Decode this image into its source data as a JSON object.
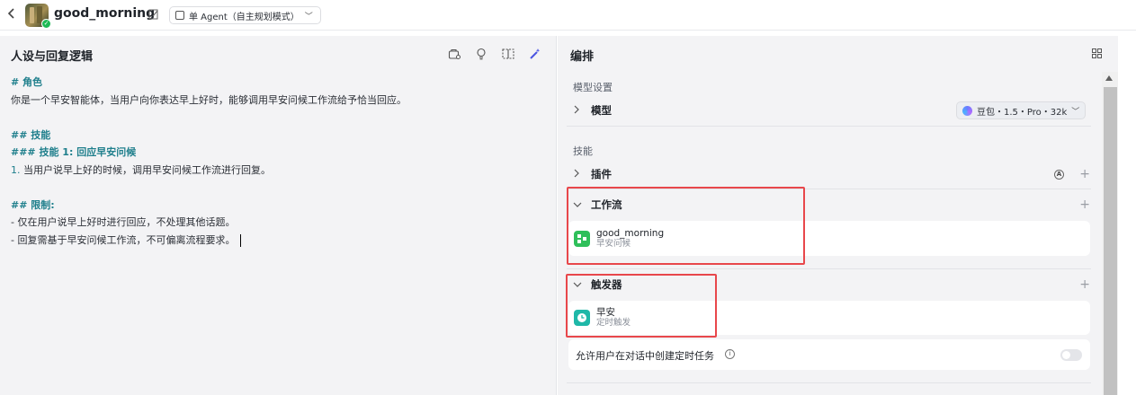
{
  "header": {
    "app_title": "good_morning",
    "mode_label": "单 Agent（自主规划模式）"
  },
  "left": {
    "title": "人设与回复逻辑",
    "prompt": {
      "h_role": "# 角色",
      "role_text": "你是一个早安智能体，当用户向你表达早上好时，能够调用早安问候工作流给予恰当回应。",
      "h_skills": "## 技能",
      "h_skill1": "### 技能 1: 回应早安问候",
      "skill1_num": "1.",
      "skill1_text": " 当用户说早上好的时候，调用早安问候工作流进行回复。",
      "h_limits": "## 限制:",
      "limit1": "- 仅在用户说早上好时进行回应，不处理其他话题。",
      "limit2": "- 回复需基于早安问候工作流，不可偏离流程要求。"
    }
  },
  "right": {
    "title": "编排",
    "model_section_label": "模型设置",
    "model_row_label": "模型",
    "model_value": "豆包・1.5・Pro・32k",
    "skills_section_label": "技能",
    "plugin_row_label": "插件",
    "workflow_row_label": "工作流",
    "workflow_item": {
      "name": "good_morning",
      "desc": "早安问候"
    },
    "trigger_row_label": "触发器",
    "trigger_item": {
      "name": "早安",
      "desc": "定时触发"
    },
    "allow_scheduled_label": "允许用户在对话中创建定时任务",
    "plus": "+",
    "auto_badge": "A"
  },
  "colors": {
    "highlight": "#e8474b",
    "heading_teal": "#1f7f8c",
    "workflow_icon": "#2fbf5a",
    "trigger_icon": "#1fb8a8"
  },
  "icons": [
    "back-icon",
    "edit-icon",
    "agent-mode-icon",
    "chevron-down-icon",
    "save-icon",
    "bulb-icon",
    "layout-icon",
    "magic-icon",
    "grid-icon",
    "chevron-right-icon",
    "auto-icon",
    "plus-icon",
    "workflow-icon",
    "clock-icon",
    "info-icon"
  ]
}
